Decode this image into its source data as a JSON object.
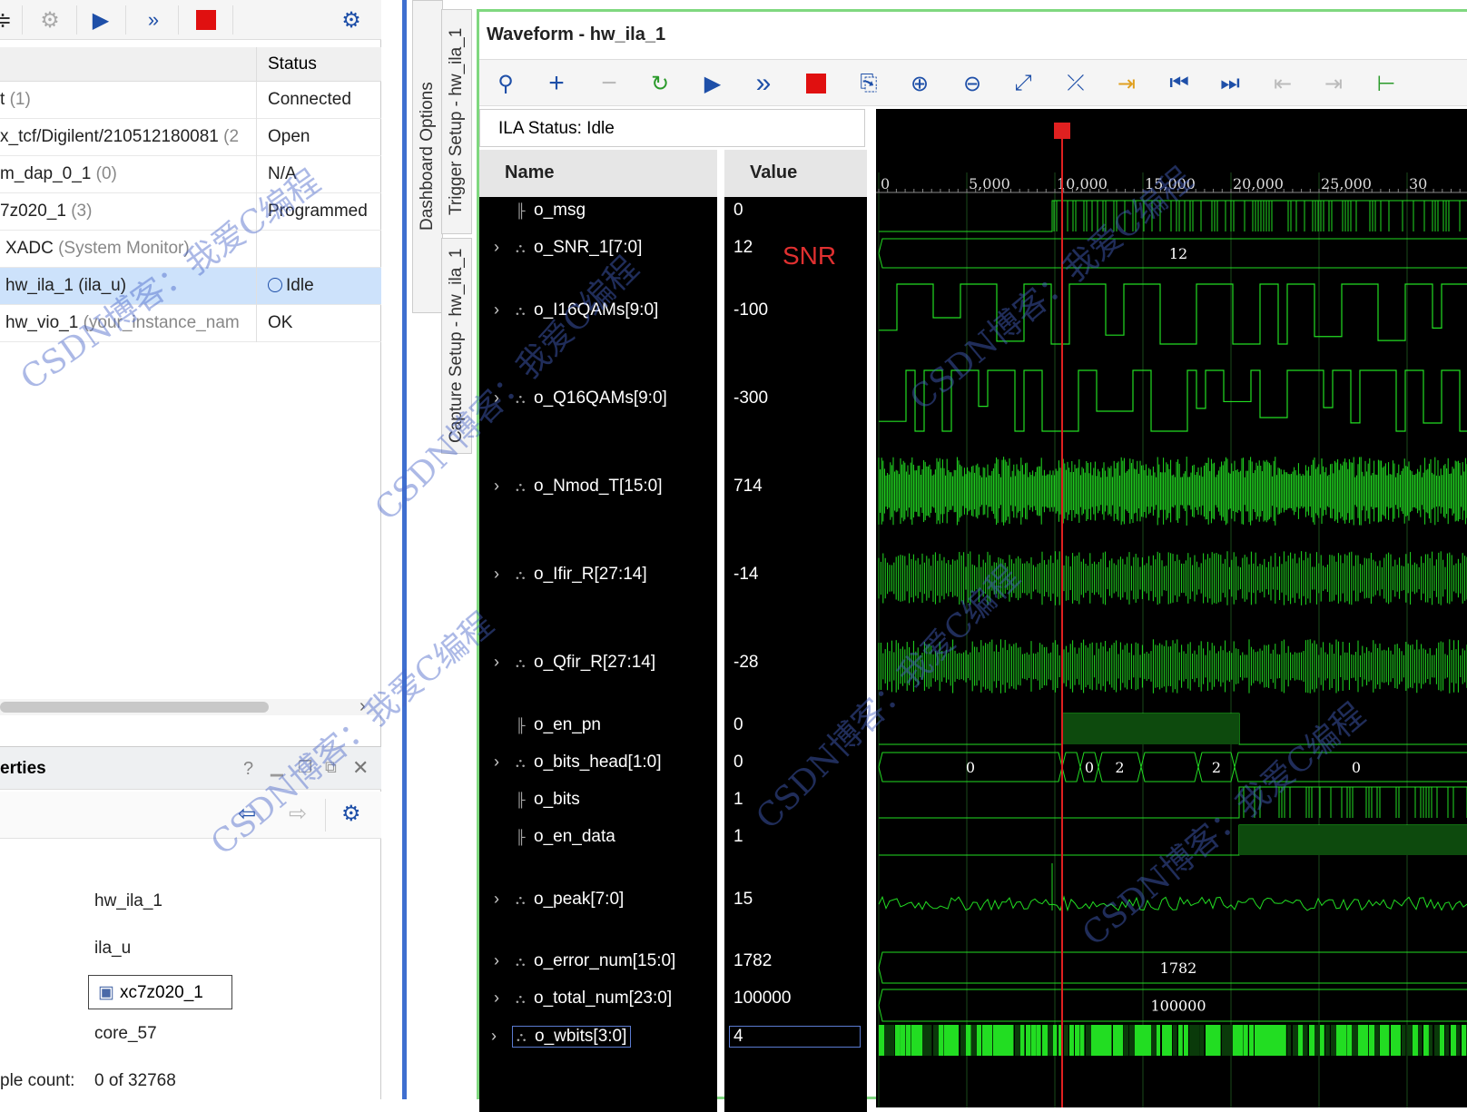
{
  "left_panel": {
    "status_header": "Status",
    "rows": [
      {
        "name": "t",
        "extra": "(1)",
        "status": "Connected"
      },
      {
        "name": "x_tcf/Digilent/210512180081",
        "extra": "(2",
        "status": "Open"
      },
      {
        "name": "m_dap_0_1",
        "extra": "(0)",
        "status": "N/A"
      },
      {
        "name": "7z020_1",
        "extra": "(3)",
        "status": "Programmed"
      },
      {
        "name": "XADC",
        "extra": "(System Monitor)",
        "status": ""
      },
      {
        "name": "hw_ila_1 (ila_u)",
        "extra": "",
        "status": "Idle"
      },
      {
        "name": "hw_vio_1",
        "extra": "(your_instance_nam",
        "status": "OK"
      }
    ],
    "properties_title": "erties",
    "help": "?",
    "props": {
      "name": "hw_ila_1",
      "cell": "ila_u",
      "device": "xc7z020_1",
      "core": "core_57",
      "sample_label": "ple count:",
      "sample_value": "0 of 32768"
    }
  },
  "vtabs": {
    "dashboard": "Dashboard Options",
    "trigger": "Trigger Setup - hw_ila_1",
    "capture": "Capture Setup - hw_ila_1"
  },
  "waveform": {
    "title": "Waveform - hw_ila_1",
    "ila_status": "ILA Status:  Idle",
    "name_header": "Name",
    "value_header": "Value",
    "snr_annotation": "SNR",
    "signals": [
      {
        "name": "o_msg",
        "value": "0",
        "bus": false
      },
      {
        "name": "o_SNR_1[7:0]",
        "value": "12",
        "bus": true
      },
      {
        "name": "o_I16QAMs[9:0]",
        "value": "-100",
        "bus": true
      },
      {
        "name": "o_Q16QAMs[9:0]",
        "value": "-300",
        "bus": true
      },
      {
        "name": "o_Nmod_T[15:0]",
        "value": "714",
        "bus": true
      },
      {
        "name": "o_Ifir_R[27:14]",
        "value": "-14",
        "bus": true
      },
      {
        "name": "o_Qfir_R[27:14]",
        "value": "-28",
        "bus": true
      },
      {
        "name": "o_en_pn",
        "value": "0",
        "bus": false
      },
      {
        "name": "o_bits_head[1:0]",
        "value": "0",
        "bus": true
      },
      {
        "name": "o_bits",
        "value": "1",
        "bus": false
      },
      {
        "name": "o_en_data",
        "value": "1",
        "bus": false
      },
      {
        "name": "o_peak[7:0]",
        "value": "15",
        "bus": true
      },
      {
        "name": "o_error_num[15:0]",
        "value": "1782",
        "bus": true
      },
      {
        "name": "o_total_num[23:0]",
        "value": "100000",
        "bus": true
      },
      {
        "name": "o_wbits[3:0]",
        "value": "4",
        "bus": true
      }
    ],
    "ruler_labels": [
      "0",
      "5,000",
      "10,000",
      "15,000",
      "20,000",
      "25,000",
      "30"
    ],
    "bus_labels": {
      "snr": "12",
      "bits_head": [
        "0",
        "0",
        "2",
        "2",
        "0"
      ],
      "error_num": "1782",
      "total_num": "100000"
    }
  },
  "watermark": [
    "CSDN博客：我爱C编程"
  ],
  "colors": {
    "wave": "#22dd22",
    "cursor": "#e02020",
    "accent_border": "#7fd87f"
  }
}
